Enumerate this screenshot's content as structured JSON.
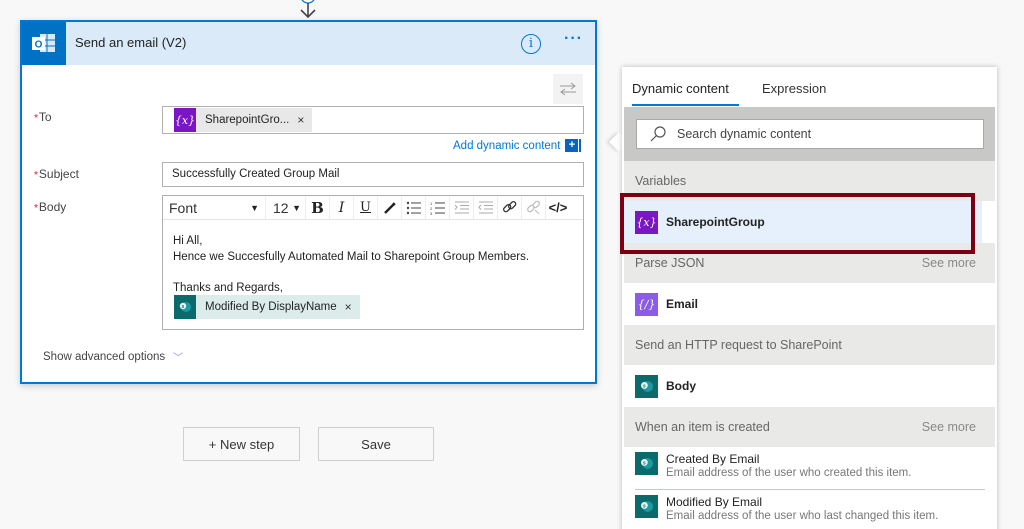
{
  "card": {
    "title": "Send an email (V2)",
    "app_icon": "outlook-icon",
    "info_icon": "info-icon",
    "more_icon": "more-options-icon",
    "info_glyph": "i",
    "more_glyph": "···"
  },
  "fields": {
    "to_label": "To",
    "subject_label": "Subject",
    "body_label": "Body",
    "required_mark": "*",
    "to_token": {
      "icon_glyph": "{x}",
      "label": "SharepointGro...",
      "remove": "×"
    },
    "add_dynamic_label": "Add dynamic content",
    "add_dynamic_plus": "+",
    "subject_value": "Successfully Created Group Mail"
  },
  "editor": {
    "font_label": "Font",
    "size_label": "12",
    "caret": "▼",
    "tools": {
      "bold": "B",
      "italic": "I",
      "underline": "U",
      "code": "</>"
    },
    "lines": [
      "Hi All,",
      "Hence we Succesfully  Automated Mail to Sharepoint Group Members.",
      "",
      "Thanks and Regards,"
    ],
    "body_token": {
      "label": "Modified By DisplayName",
      "remove": "×"
    }
  },
  "advanced_label": "Show advanced options",
  "advanced_chevron": "﹀",
  "buttons": {
    "new_step": "+ New step",
    "save": "Save"
  },
  "panel": {
    "tabs": [
      {
        "label": "Dynamic content",
        "active": true
      },
      {
        "label": "Expression",
        "active": false
      }
    ],
    "search_placeholder": "Search dynamic content",
    "see_more": "See more",
    "groups": [
      {
        "title": "Variables",
        "items": [
          {
            "label": "SharepointGroup",
            "icon_glyph": "{x}",
            "selected": true
          }
        ]
      },
      {
        "title": "Parse JSON",
        "items": [
          {
            "label": "Email",
            "icon_glyph": "{/}"
          }
        ]
      },
      {
        "title": "Send an HTTP request to SharePoint",
        "items": [
          {
            "label": "Body"
          }
        ]
      },
      {
        "title": "When an item is created",
        "items": [
          {
            "label": "Created By Email",
            "description": "Email address of the user who created this item."
          },
          {
            "label": "Modified By Email",
            "description": "Email address of the user who last changed this item."
          }
        ]
      }
    ]
  },
  "colors": {
    "accent": "#0078d4",
    "variable_purple": "#7b16c4",
    "sharepoint_teal": "#0b6a6b",
    "highlight_border": "#7b0014"
  }
}
